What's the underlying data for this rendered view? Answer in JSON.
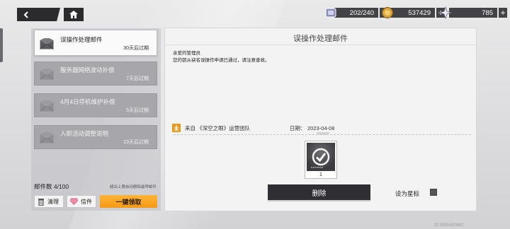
{
  "topbar": {
    "resources": [
      {
        "icon": "stamina-icon",
        "value": "202/240"
      },
      {
        "icon": "coin-icon",
        "value": "537429"
      },
      {
        "icon": "crystal-icon",
        "value": "785"
      }
    ]
  },
  "mail_list": {
    "items": [
      {
        "title": "误操作处理邮件",
        "expire": "30天后过期",
        "active": true
      },
      {
        "title": "服务器网络波动补偿",
        "expire": "7天后过期",
        "active": false
      },
      {
        "title": "4月4日停机维护补偿",
        "expire": "5天后过期",
        "active": false
      },
      {
        "title": "入职活动调整说明",
        "expire": "23天后过期",
        "active": false
      }
    ],
    "count_label": "邮件数 4/100",
    "limit_note": "超出上限自动删除最早邮件",
    "clear_label": "清理",
    "letter_label": "信件",
    "claim_all_label": "一键领取"
  },
  "detail": {
    "title": "误操作处理邮件",
    "greeting": "亲爱的管理员",
    "body": "您的钥从袂名误操作申请已通过，请注意查收。",
    "sender": "来自 《深空之眼》运营团队",
    "date_label": "日期：",
    "date": "2023-04-08",
    "attachment_count": "1",
    "delete_label": "删除",
    "star_label": "设为星标"
  },
  "uid": "ID:3081430962",
  "colors": {
    "accent_orange": "#f39a14",
    "dark_button": "#2f2f33"
  }
}
